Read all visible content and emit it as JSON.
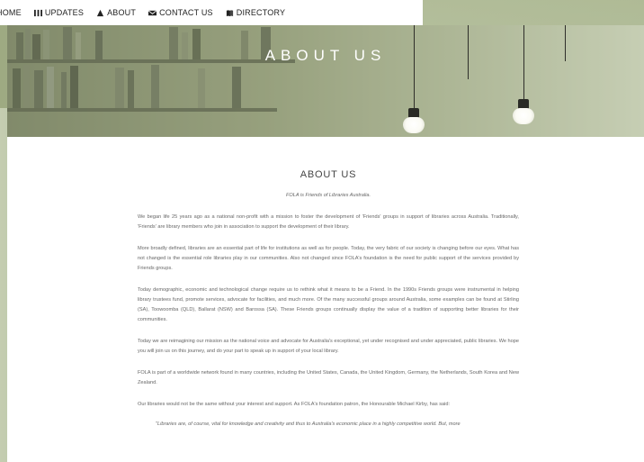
{
  "nav": {
    "items": [
      {
        "label": "HOME",
        "icon": "none"
      },
      {
        "label": "UPDATES",
        "icon": "grid-icon"
      },
      {
        "label": "ABOUT",
        "icon": "person-icon"
      },
      {
        "label": "CONTACT US",
        "icon": "envelope-icon"
      },
      {
        "label": "DIRECTORY",
        "icon": "book-icon"
      }
    ]
  },
  "hero": {
    "title": "ABOUT US"
  },
  "article": {
    "heading": "ABOUT US",
    "tagline": "FOLA is Friends of Libraries Australia.",
    "paragraphs": [
      "We began life 25 years ago as a national non-profit with a mission to foster the development of 'Friends' groups in support of libraries across Australia. Traditionally, 'Friends' are library members who join in association to support the development of their library.",
      "More broadly defined, libraries are an essential part of life for institutions as well as for people. Today, the very fabric of our society is changing before our eyes. What has not changed is the essential role libraries play in our communities. Also not changed since FOLA's foundation is the need for public support of the services provided by Friends groups.",
      "Today demographic, economic and technological change require us to rethink what it means to be a Friend. In the 1990s Friends groups were instrumental in helping library trustees fund, promote services, advocate for facilities, and much more. Of the many successful groups around Australia, some examples can be found at Stirling (SA), Toowoomba (QLD), Ballarat (NSW) and Barossa (SA). These Friends groups continually display the value of a tradition of supporting better libraries for their communities.",
      "Today we are reimagining our mission as the national voice and advocate for Australia's exceptional, yet under recognised and under appreciated, public libraries. We hope you will join us on this journey, and do your part to speak up in support of your local library.",
      "FOLA is part of a worldwide network found in many countries, including the United States, Canada, the United Kingdom, Germany, the Netherlands, South Korea and New Zealand.",
      "Our libraries would not be the same without your interest and support. As FOLA's foundation patron, the Honourable Michael Kirby, has said:"
    ],
    "quote": "\"Libraries are, of course, vital for knowledge and creativity and thus to Australia's economic place in a highly competitive world. But, more"
  },
  "colors": {
    "page_background": "#a9b58f",
    "panel_background": "#ffffff",
    "text": "#666666",
    "hero_title": "#ffffff"
  }
}
